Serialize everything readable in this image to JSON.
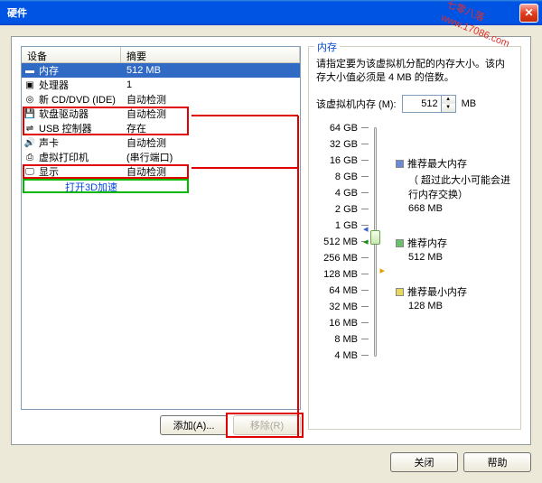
{
  "title": "硬件",
  "list": {
    "col_device": "设备",
    "col_summary": "摘要",
    "rows": [
      {
        "icon": "memory-icon",
        "device": "内存",
        "summary": "512 MB",
        "selected": true
      },
      {
        "icon": "cpu-icon",
        "device": "处理器",
        "summary": "1"
      },
      {
        "icon": "cd-icon",
        "device": "新 CD/DVD (IDE)",
        "summary": "自动检测"
      },
      {
        "icon": "floppy-icon",
        "device": "软盘驱动器",
        "summary": "自动检测"
      },
      {
        "icon": "usb-icon",
        "device": "USB 控制器",
        "summary": "存在"
      },
      {
        "icon": "sound-icon",
        "device": "声卡",
        "summary": "自动检测"
      },
      {
        "icon": "printer-icon",
        "device": "虚拟打印机",
        "summary": "(串行端口)"
      },
      {
        "icon": "display-icon",
        "device": "显示",
        "summary": "自动检测"
      }
    ]
  },
  "buttons": {
    "add": "添加(A)...",
    "remove": "移除(R)",
    "close": "关闭",
    "help": "帮助"
  },
  "memory": {
    "group_title": "内存",
    "desc": "请指定要为该虚拟机分配的内存大小。该内存大小值必须是 4 MB 的倍数。",
    "label": "该虚拟机内存 (M):",
    "value": "512",
    "unit": "MB",
    "ticks": [
      "64 GB",
      "32 GB",
      "16 GB",
      "8 GB",
      "4 GB",
      "2 GB",
      "1 GB",
      "512 MB",
      "256 MB",
      "128 MB",
      "64 MB",
      "32 MB",
      "16 MB",
      "8 MB",
      "4 MB"
    ],
    "legend": {
      "max_title": "推荐最大内存",
      "max_sub": "（ 超过此大小可能会进行内存交换）",
      "max_val": "668 MB",
      "rec_title": "推荐内存",
      "rec_val": "512 MB",
      "min_title": "推荐最小内存",
      "min_val": "128 MB"
    }
  },
  "overlay": "打开3D加速",
  "watermark_a": "七零八落",
  "watermark_b": "www.17086.com",
  "colors": {
    "legend_blue": "#6a8ad8",
    "legend_green": "#6abf6a",
    "legend_yellow": "#e8d85a"
  }
}
